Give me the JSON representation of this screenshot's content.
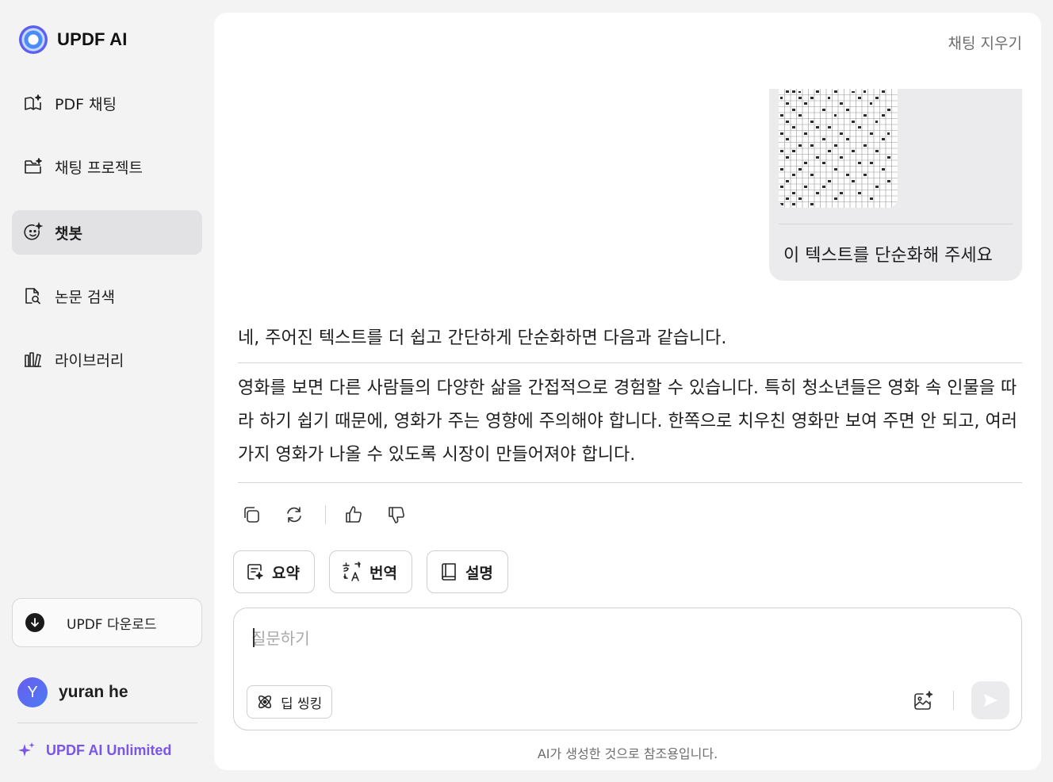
{
  "brand": {
    "name": "UPDF AI"
  },
  "sidebar": {
    "items": [
      {
        "label": "PDF 채팅",
        "icon": "book-sparkle-icon",
        "active": false
      },
      {
        "label": "채팅 프로젝트",
        "icon": "folder-sparkle-icon",
        "active": false
      },
      {
        "label": "챗봇",
        "icon": "chatbot-face-icon",
        "active": true
      },
      {
        "label": "논문 검색",
        "icon": "document-search-icon",
        "active": false
      },
      {
        "label": "라이브러리",
        "icon": "library-icon",
        "active": false
      }
    ],
    "download_label": "UPDF 다운로드",
    "user": {
      "initial": "Y",
      "name": "yuran he"
    },
    "plan_label": "UPDF AI Unlimited"
  },
  "main": {
    "clear_chat_label": "채팅 지우기",
    "user_message": {
      "text": "이 텍스트를 단순화해 주세요",
      "attachment": "handwritten-manuscript-image"
    },
    "ai_message": {
      "intro": "네, 주어진 텍스트를 더 쉽고 간단하게 단순화하면 다음과 같습니다.",
      "body": "영화를 보면 다른 사람들의 다양한 삶을 간접적으로 경험할 수 있습니다. 특히 청소년들은 영화 속 인물을 따라 하기 쉽기 때문에, 영화가 주는 영향에 주의해야 합니다. 한쪽으로 치우친 영화만 보여 주면 안 되고, 여러 가지 영화가 나올 수 있도록 시장이 만들어져야 합니다."
    },
    "actions": [
      {
        "label": "요약",
        "icon": "summary-icon"
      },
      {
        "label": "번역",
        "icon": "translate-icon"
      },
      {
        "label": "설명",
        "icon": "book-icon"
      }
    ],
    "input": {
      "placeholder": "질문하기",
      "value": ""
    },
    "deep_think_label": "딥 씽킹",
    "disclaimer": "AI가 생성한 것으로 참조용입니다."
  },
  "colors": {
    "accent": "#7a56e8",
    "active_bg": "#e2e2e4",
    "panel_bg": "#ffffff",
    "app_bg": "#f3f3f4"
  }
}
